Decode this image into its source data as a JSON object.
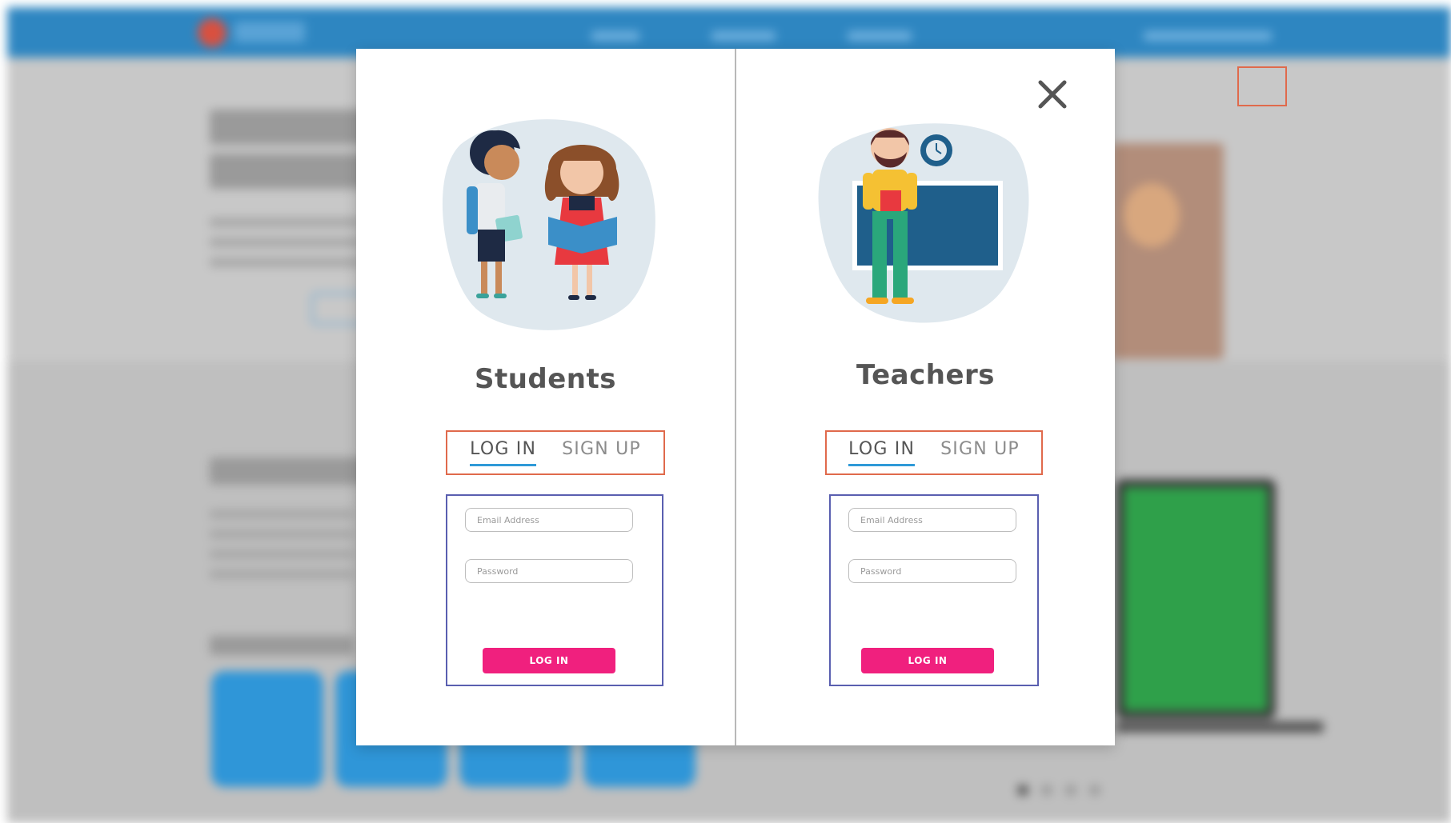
{
  "modal": {
    "close_icon": "close-icon",
    "students": {
      "title": "Students",
      "tabs": [
        {
          "label": "LOG IN",
          "active": true
        },
        {
          "label": "SIGN UP",
          "active": false
        }
      ],
      "email_placeholder": "Email Address",
      "password_placeholder": "Password",
      "login_button": "LOG IN"
    },
    "teachers": {
      "title": "Teachers",
      "tabs": [
        {
          "label": "LOG IN",
          "active": true
        },
        {
          "label": "SIGN UP",
          "active": false
        }
      ],
      "email_placeholder": "Email Address",
      "password_placeholder": "Password",
      "login_button": "LOG IN"
    }
  },
  "colors": {
    "accent_pink": "#f0207e",
    "tab_underline": "#2f9ad8",
    "highlight_red": "#e06a4c",
    "form_border": "#5a5fb0",
    "nav_blue": "#2e86c1"
  }
}
